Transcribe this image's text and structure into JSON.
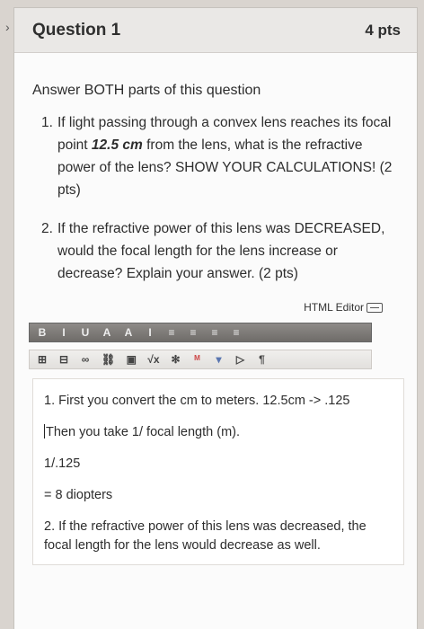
{
  "quiz": {
    "question_title": "Question 1",
    "points": "4 pts",
    "intro": "Answer BOTH parts of this question",
    "parts": [
      {
        "num": "1.",
        "text_before": "If light passing through a convex lens reaches its focal point ",
        "emphasis": "12.5 cm",
        "text_after": " from the lens, what is the refractive power of the lens? SHOW YOUR CALCULATIONS! (2 pts)"
      },
      {
        "num": "2.",
        "text": "If the refractive power of this lens was DECREASED, would the focal length for the lens increase or decrease? Explain your answer. (2 pts)"
      }
    ]
  },
  "editor": {
    "html_editor_label": "HTML Editor",
    "toolbar_row1": [
      "B",
      "I",
      "U",
      "A",
      "A",
      "I",
      "≡",
      "≡",
      "≡",
      "≡"
    ],
    "toolbar_row2": [
      "⊞",
      "⊟",
      "∞",
      "⛓",
      "▣",
      "√x",
      "✻",
      "ᴹ",
      "▾",
      "▷",
      "¶"
    ]
  },
  "answer": {
    "lines": [
      "1. First you convert the cm to meters. 12.5cm -> .125",
      "Then you take 1/ focal length (m).",
      "1/.125",
      "= 8 diopters",
      "2. If the refractive power of this lens was decreased, the focal length for the lens would decrease as well."
    ]
  }
}
